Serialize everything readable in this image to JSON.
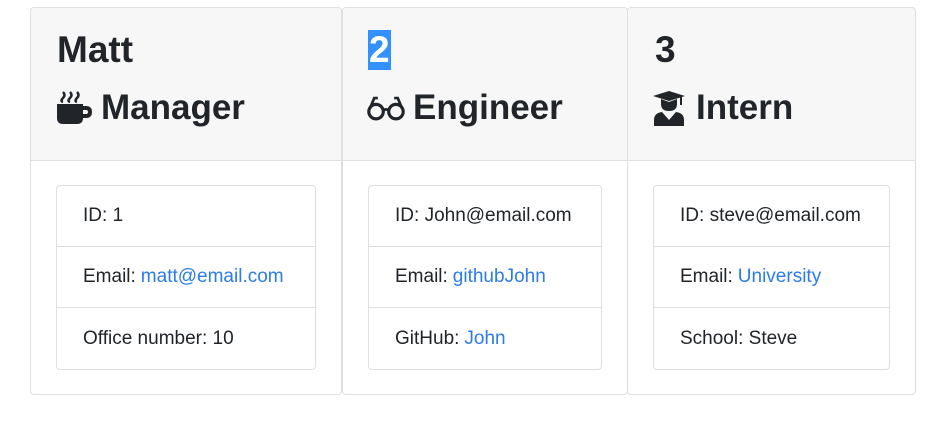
{
  "cards": [
    {
      "name": "Matt",
      "role": "Manager",
      "role_icon": "coffee-mug-icon",
      "items": [
        {
          "label": "ID:",
          "value": "1"
        },
        {
          "label": "Email:",
          "link": "matt@email.com"
        },
        {
          "label": "Office number:",
          "value": "10"
        }
      ]
    },
    {
      "name": "2",
      "role": "Engineer",
      "role_icon": "glasses-icon",
      "items": [
        {
          "label": "ID:",
          "value": "John@email.com"
        },
        {
          "label": "Email:",
          "link": "githubJohn"
        },
        {
          "label": "GitHub:",
          "link": "John"
        }
      ]
    },
    {
      "name": "3",
      "role": "Intern",
      "role_icon": "graduate-icon",
      "items": [
        {
          "label": "ID:",
          "value": "steve@email.com"
        },
        {
          "label": "Email:",
          "link": "University"
        },
        {
          "label": "School:",
          "value": "Steve"
        }
      ]
    }
  ],
  "colors": {
    "link": "#2b7ce9",
    "selection": "#3390ff",
    "header_bg": "#f7f7f7",
    "border": "#dfdfdf"
  }
}
